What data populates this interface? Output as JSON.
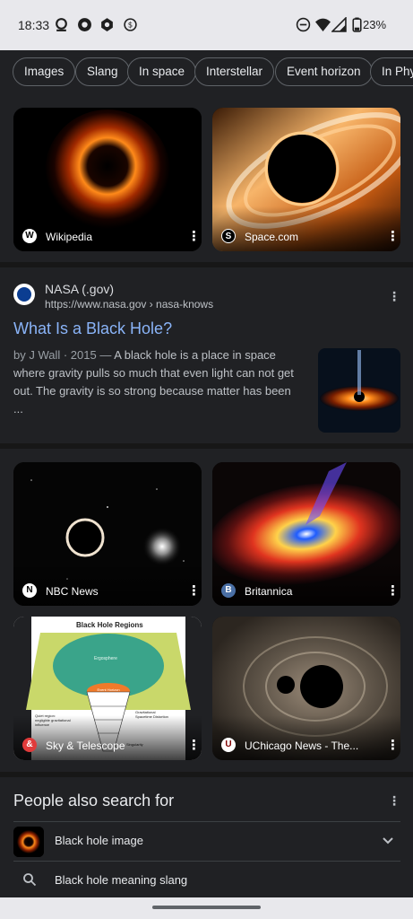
{
  "status_bar": {
    "time": "18:33",
    "battery": "23%",
    "icons": [
      "notification-icon",
      "chrome-icon",
      "settings-icon",
      "sync-icon",
      "dnd-icon",
      "wifi-icon",
      "signal-icon",
      "battery-icon"
    ]
  },
  "chips": [
    "Images",
    "Slang",
    "In space",
    "Interstellar",
    "Event horizon",
    "In Phys"
  ],
  "image_row_1": [
    {
      "source": "Wikipedia",
      "icon_letter": "W"
    },
    {
      "source": "Space.com",
      "icon_letter": "S"
    }
  ],
  "result": {
    "site": "NASA (.gov)",
    "url": "https://www.nasa.gov › nasa-knows",
    "title": "What Is a Black Hole?",
    "meta": "by J Wall · 2015 — ",
    "snippet": "A black hole is a place in space where gravity pulls so much that even light can not get out. The gravity is so strong because matter has been ..."
  },
  "image_grid": [
    {
      "source": "NBC News",
      "icon_letter": "N"
    },
    {
      "source": "Britannica",
      "icon_letter": "B"
    },
    {
      "source": "Sky & Telescope",
      "icon_letter": "&"
    },
    {
      "source": "UChicago News - The...",
      "icon_letter": "U"
    }
  ],
  "diagram": {
    "title": "Black Hole Regions",
    "labels": [
      "Ergosphere",
      "Event Horizon",
      "Quiet region: negligible gravitational influence",
      "Gravitational Spacetime Distortion",
      "Singularity"
    ]
  },
  "people_also_search": {
    "title": "People also search for",
    "items": [
      "Black hole image",
      "Black hole meaning slang"
    ]
  },
  "colors": {
    "link": "#8ab4f8",
    "background": "#202124",
    "status_bar": "#e8e8ec"
  }
}
